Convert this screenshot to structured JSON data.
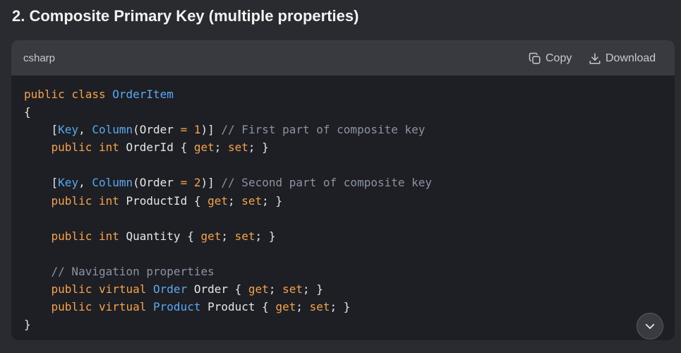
{
  "heading": "2. Composite Primary Key (multiple properties)",
  "code_block": {
    "language": "csharp",
    "copy_label": "Copy",
    "download_label": "Download",
    "lines": [
      [
        {
          "t": "public class ",
          "c": "kw"
        },
        {
          "t": "OrderItem",
          "c": "ty"
        }
      ],
      [
        {
          "t": "{",
          "c": "pl"
        }
      ],
      [
        {
          "t": "    [",
          "c": "pl"
        },
        {
          "t": "Key",
          "c": "ty"
        },
        {
          "t": ", ",
          "c": "pl"
        },
        {
          "t": "Column",
          "c": "ty"
        },
        {
          "t": "(Order ",
          "c": "pl"
        },
        {
          "t": "=",
          "c": "kw"
        },
        {
          "t": " ",
          "c": "pl"
        },
        {
          "t": "1",
          "c": "nm"
        },
        {
          "t": ")] ",
          "c": "pl"
        },
        {
          "t": "// First part of composite key",
          "c": "cm"
        }
      ],
      [
        {
          "t": "    public int ",
          "c": "kw"
        },
        {
          "t": "OrderId { ",
          "c": "pl"
        },
        {
          "t": "get",
          "c": "kw"
        },
        {
          "t": "; ",
          "c": "pl"
        },
        {
          "t": "set",
          "c": "kw"
        },
        {
          "t": "; }",
          "c": "pl"
        }
      ],
      [
        {
          "t": "",
          "c": "pl"
        }
      ],
      [
        {
          "t": "    [",
          "c": "pl"
        },
        {
          "t": "Key",
          "c": "ty"
        },
        {
          "t": ", ",
          "c": "pl"
        },
        {
          "t": "Column",
          "c": "ty"
        },
        {
          "t": "(Order ",
          "c": "pl"
        },
        {
          "t": "=",
          "c": "kw"
        },
        {
          "t": " ",
          "c": "pl"
        },
        {
          "t": "2",
          "c": "nm"
        },
        {
          "t": ")] ",
          "c": "pl"
        },
        {
          "t": "// Second part of composite key",
          "c": "cm"
        }
      ],
      [
        {
          "t": "    public int ",
          "c": "kw"
        },
        {
          "t": "ProductId { ",
          "c": "pl"
        },
        {
          "t": "get",
          "c": "kw"
        },
        {
          "t": "; ",
          "c": "pl"
        },
        {
          "t": "set",
          "c": "kw"
        },
        {
          "t": "; }",
          "c": "pl"
        }
      ],
      [
        {
          "t": "",
          "c": "pl"
        }
      ],
      [
        {
          "t": "    public int ",
          "c": "kw"
        },
        {
          "t": "Quantity { ",
          "c": "pl"
        },
        {
          "t": "get",
          "c": "kw"
        },
        {
          "t": "; ",
          "c": "pl"
        },
        {
          "t": "set",
          "c": "kw"
        },
        {
          "t": "; }",
          "c": "pl"
        }
      ],
      [
        {
          "t": "",
          "c": "pl"
        }
      ],
      [
        {
          "t": "    // Navigation properties",
          "c": "cm"
        }
      ],
      [
        {
          "t": "    public virtual ",
          "c": "kw"
        },
        {
          "t": "Order",
          "c": "ty"
        },
        {
          "t": " Order { ",
          "c": "pl"
        },
        {
          "t": "get",
          "c": "kw"
        },
        {
          "t": "; ",
          "c": "pl"
        },
        {
          "t": "set",
          "c": "kw"
        },
        {
          "t": "; }",
          "c": "pl"
        }
      ],
      [
        {
          "t": "    public virtual ",
          "c": "kw"
        },
        {
          "t": "Product",
          "c": "ty"
        },
        {
          "t": " Product { ",
          "c": "pl"
        },
        {
          "t": "get",
          "c": "kw"
        },
        {
          "t": "; ",
          "c": "pl"
        },
        {
          "t": "set",
          "c": "kw"
        },
        {
          "t": "; }",
          "c": "pl"
        }
      ],
      [
        {
          "t": "}",
          "c": "pl"
        }
      ]
    ]
  },
  "icons": {
    "copy": "copy-icon",
    "download": "download-icon",
    "scroll_down": "chevron-down-icon"
  },
  "colors": {
    "keyword": "#f4a34d",
    "type": "#5aa9f1",
    "comment": "#8b93a3",
    "plain": "#e6e6e6",
    "background": "#2a2b31",
    "code_background": "#1e1f24",
    "header_background": "#393a40"
  }
}
